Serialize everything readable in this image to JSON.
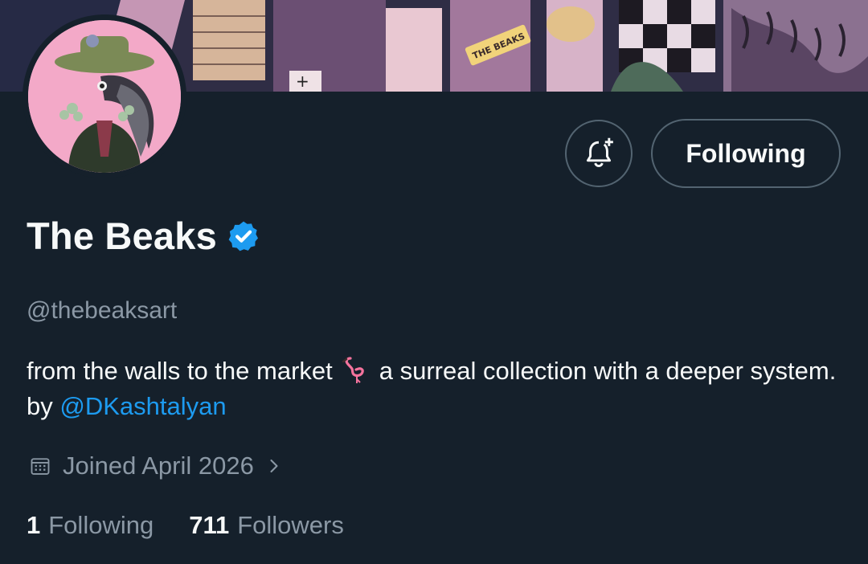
{
  "banner": {
    "sign_text": "THE BEAKS"
  },
  "profile": {
    "display_name": "The Beaks",
    "handle": "@thebeaksart",
    "verified": true,
    "bio_text_1": "from the walls to the market",
    "bio_emoji": "flamingo",
    "bio_text_2": "a surreal collection with a deeper system. by",
    "bio_mention": "@DKashtalyan",
    "joined": "Joined April 2026"
  },
  "actions": {
    "notify_icon": "bell-plus-icon",
    "follow_label": "Following"
  },
  "stats": {
    "following_count": "1",
    "following_label": "Following",
    "followers_count": "711",
    "followers_label": "Followers"
  },
  "colors": {
    "background": "#15202b",
    "primary_text": "#f7f9f9",
    "secondary_text": "#8b98a5",
    "accent": "#1d9bf0",
    "border": "#536471",
    "avatar_bg": "#f3a9c8"
  }
}
